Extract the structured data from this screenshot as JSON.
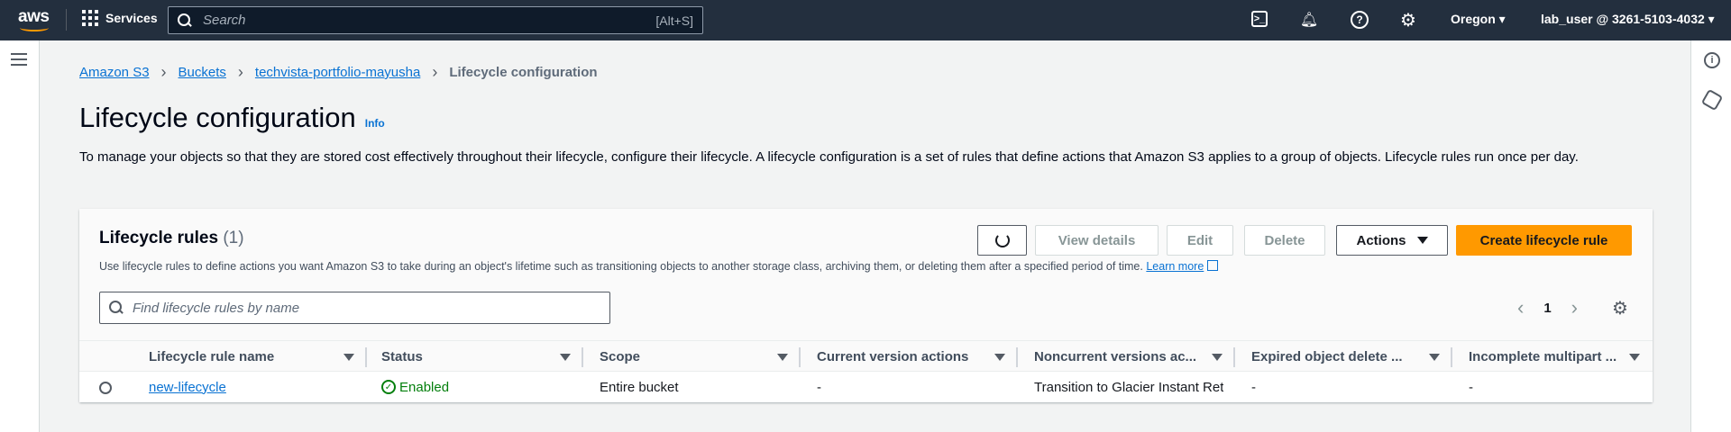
{
  "topnav": {
    "logo_text": "aws",
    "services_label": "Services",
    "search_placeholder": "Search",
    "search_shortcut": "[Alt+S]",
    "region": "Oregon",
    "user": "lab_user @ 3261-5103-4032",
    "icons": [
      "cloudshell-icon",
      "bell-icon",
      "help-icon",
      "gear-icon"
    ]
  },
  "breadcrumb": [
    "Amazon S3",
    "Buckets",
    "techvista-portfolio-mayusha",
    "Lifecycle configuration"
  ],
  "page": {
    "title": "Lifecycle configuration",
    "info_label": "Info",
    "description": "To manage your objects so that they are stored cost effectively throughout their lifecycle, configure their lifecycle. A lifecycle configuration is a set of rules that define actions that Amazon S3 applies to a group of objects. Lifecycle rules run once per day."
  },
  "panel": {
    "title": "Lifecycle rules",
    "count": "(1)",
    "description": "Use lifecycle rules to define actions you want Amazon S3 to take during an object's lifetime such as transitioning objects to another storage class, archiving them, or deleting them after a specified period of time.",
    "learn_more": "Learn more",
    "buttons": {
      "view_details": "View details",
      "edit": "Edit",
      "delete": "Delete",
      "actions": "Actions",
      "create": "Create lifecycle rule"
    },
    "filter_placeholder": "Find lifecycle rules by name",
    "page_number": "1",
    "accent_color": "#ff9900"
  },
  "table": {
    "columns": [
      "Lifecycle rule name",
      "Status",
      "Scope",
      "Current version actions",
      "Noncurrent versions ac...",
      "Expired object delete ...",
      "Incomplete multipart ..."
    ],
    "rows": [
      {
        "name": "new-lifecycle",
        "status": "Enabled",
        "scope": "Entire bucket",
        "current": "-",
        "noncurrent": "Transition to Glacier Instant Retr",
        "expired": "-",
        "incomplete": "-"
      }
    ]
  }
}
